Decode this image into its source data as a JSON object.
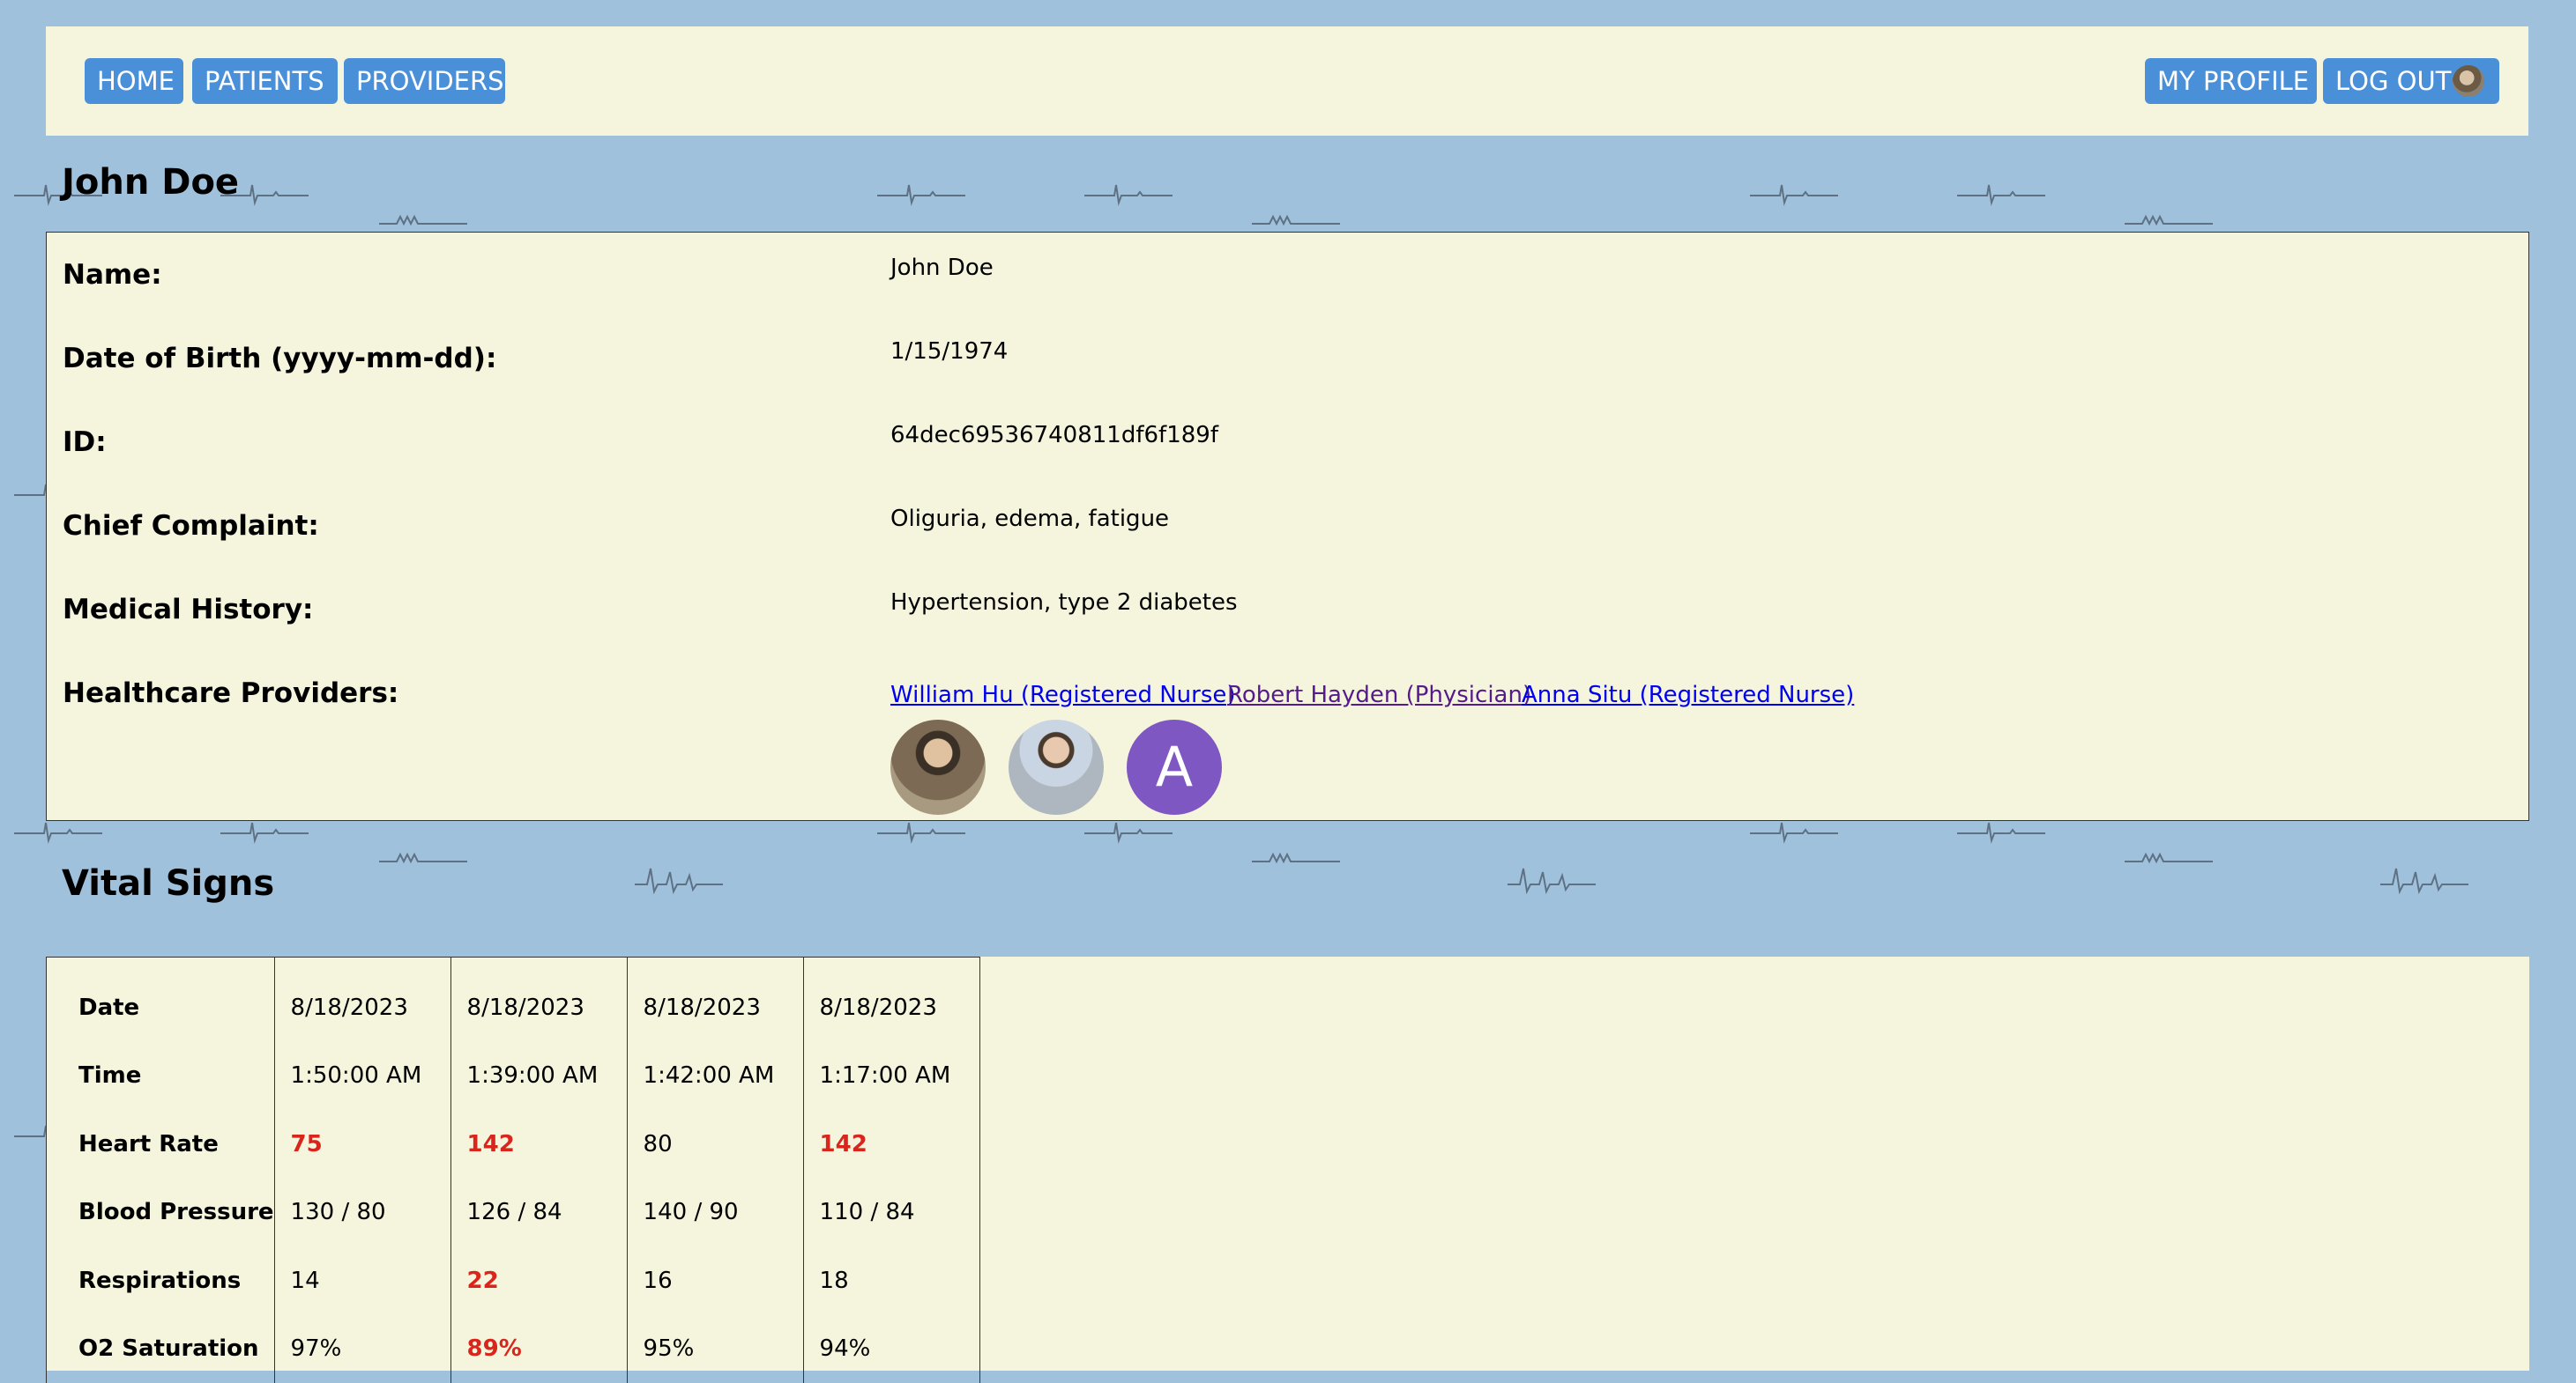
{
  "nav": {
    "home": "HOME",
    "patients": "PATIENTS",
    "providers": "PROVIDERS",
    "my_profile": "MY PROFILE",
    "log_out": "LOG OUT"
  },
  "patient": {
    "heading": "John Doe",
    "fields": [
      {
        "label": "Name:",
        "value": "John Doe"
      },
      {
        "label": "Date of Birth (yyyy-mm-dd):",
        "value": "1/15/1974"
      },
      {
        "label": "ID:",
        "value": "64dec69536740811df6f189f"
      },
      {
        "label": "Chief Complaint:",
        "value": "Oliguria, edema, fatigue"
      },
      {
        "label": "Medical History:",
        "value": "Hypertension, type 2 diabetes"
      }
    ],
    "providers_label": "Healthcare Providers:",
    "providers": [
      {
        "name": "William Hu (Registered Nurse)",
        "avatar": "photo"
      },
      {
        "name": "Robert Hayden (Physician)",
        "avatar": "photo"
      },
      {
        "name": "Anna Situ (Registered Nurse)",
        "avatar": "A"
      }
    ]
  },
  "vitals": {
    "heading": "Vital Signs",
    "rows": [
      {
        "label": "Date",
        "values": [
          "8/18/2023",
          "8/18/2023",
          "8/18/2023",
          "8/18/2023"
        ],
        "abnormal": [
          false,
          false,
          false,
          false
        ]
      },
      {
        "label": "Time",
        "values": [
          "1:50:00 AM",
          "1:39:00 AM",
          "1:42:00 AM",
          "1:17:00 AM"
        ],
        "abnormal": [
          false,
          false,
          false,
          false
        ]
      },
      {
        "label": "Heart Rate",
        "values": [
          "75",
          "142",
          "80",
          "142"
        ],
        "abnormal": [
          true,
          true,
          false,
          true
        ]
      },
      {
        "label": "Blood Pressure",
        "values": [
          "130 / 80",
          "126 / 84",
          "140 / 90",
          "110 / 84"
        ],
        "abnormal": [
          false,
          false,
          false,
          false
        ]
      },
      {
        "label": "Respirations",
        "values": [
          "14",
          "22",
          "16",
          "18"
        ],
        "abnormal": [
          false,
          true,
          false,
          false
        ]
      },
      {
        "label": "O2 Saturation",
        "values": [
          "97%",
          "89%",
          "95%",
          "94%"
        ],
        "abnormal": [
          false,
          true,
          false,
          false
        ]
      }
    ]
  },
  "colors": {
    "background": "#a0c1dc",
    "panel": "#f5f5dd",
    "nav_button": "#4a90d9",
    "abnormal": "#d9261c",
    "avatar_purple": "#7e57c2"
  }
}
